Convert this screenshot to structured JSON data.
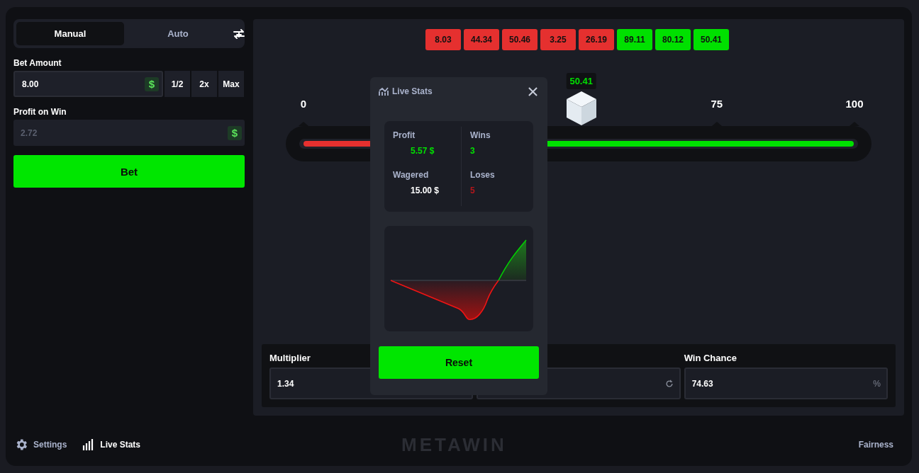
{
  "mode_tabs": [
    {
      "label": "Manual",
      "selected": true
    },
    {
      "label": "Auto",
      "selected": false
    }
  ],
  "bet_amount": {
    "label": "Bet Amount",
    "value": "8.00",
    "currency": "$",
    "quick_buttons": [
      "1/2",
      "2x",
      "Max"
    ]
  },
  "profit_on_win": {
    "label": "Profit on Win",
    "value": "2.72",
    "currency": "$",
    "disabled": true
  },
  "bet_button": "Bet",
  "history": [
    {
      "value": "8.03",
      "color": "#e5302f"
    },
    {
      "value": "44.34",
      "color": "#e5302f"
    },
    {
      "value": "50.46",
      "color": "#e5302f"
    },
    {
      "value": "3.25",
      "color": "#e5302f"
    },
    {
      "value": "26.19",
      "color": "#e5302f"
    },
    {
      "value": "89.11",
      "color": "#00e000"
    },
    {
      "value": "80.12",
      "color": "#00e000"
    },
    {
      "value": "50.41",
      "color": "#00e000"
    }
  ],
  "slider": {
    "ticks": [
      "0",
      "75",
      "100"
    ],
    "level": 0.2537,
    "result": {
      "value": "50.41",
      "level": 0.5041,
      "win": true
    }
  },
  "inputs": [
    {
      "kind": "text",
      "label": "Multiplier",
      "value": "1.34"
    },
    {
      "kind": "refresh"
    },
    {
      "kind": "percent",
      "label": "Win Chance",
      "value": "74.63",
      "suffix": "%"
    }
  ],
  "live_stats": {
    "title": "Live Stats",
    "stats": [
      {
        "label": "Profit",
        "value": "5.57 $",
        "color": "#00e000"
      },
      {
        "label": "Wins",
        "value": "3",
        "color": "#00e000"
      },
      {
        "label": "Wagered",
        "value": "15.00 $",
        "color": "#ffffff"
      },
      {
        "label": "Loses",
        "value": "5",
        "color": "#b3161b"
      }
    ],
    "reset_button": "Reset"
  },
  "footer": {
    "items": [
      {
        "kind": "gear",
        "label": "Settings",
        "selected": false
      },
      {
        "kind": "bars",
        "label": "Live Stats",
        "selected": true
      }
    ],
    "logo": "METAWIN",
    "fairness": "Fairness"
  }
}
